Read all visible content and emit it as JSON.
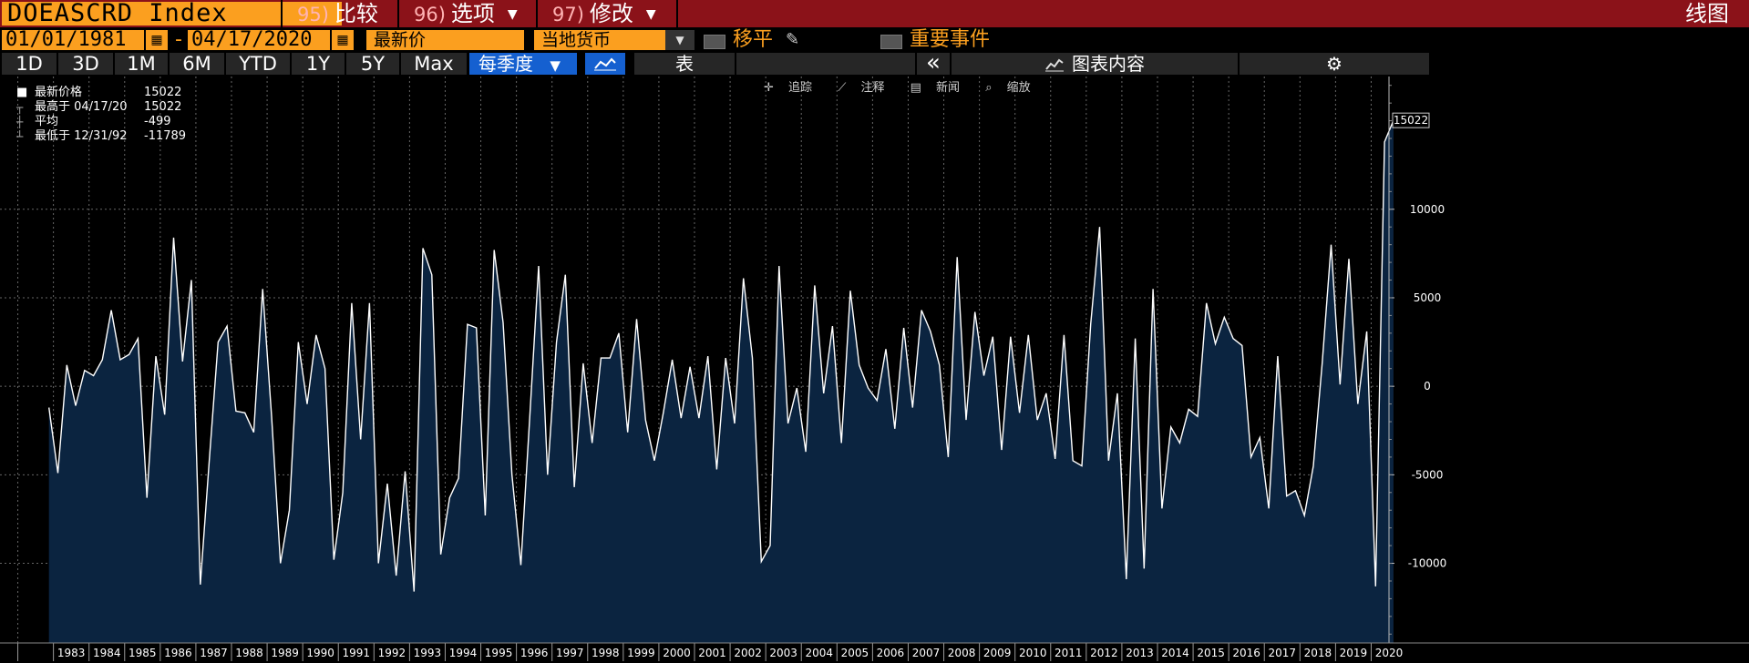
{
  "header": {
    "ticker": "DOEASCRD Index",
    "menu": [
      {
        "num": "95)",
        "label": "比较",
        "caret": false
      },
      {
        "num": "96)",
        "label": "选项",
        "caret": true
      },
      {
        "num": "97)",
        "label": "修改",
        "caret": true
      }
    ],
    "title_right": "线图"
  },
  "controls": {
    "start_date": "01/01/1981",
    "end_date": "04/17/2020",
    "dash": "-",
    "field": "最新价",
    "currency": "当地货币",
    "moving_avg_label": "移平",
    "events_label": "重要事件",
    "moving_avg_checked": false,
    "events_checked": false
  },
  "periods": [
    "1D",
    "3D",
    "1M",
    "6M",
    "YTD",
    "1Y",
    "5Y",
    "Max"
  ],
  "toolbar": {
    "frequency": "每季度",
    "table_label": "表",
    "collapse_glyph": "«",
    "chart_content_label": "图表内容"
  },
  "annotations": [
    "追踪",
    "注释",
    "新闻",
    "缩放"
  ],
  "legend": [
    {
      "label": "最新价格",
      "value": "15022",
      "marker": "square-icon"
    },
    {
      "label": "最高于 04/17/20",
      "value": "15022",
      "marker": "high-icon"
    },
    {
      "label": "平均",
      "value": "-499",
      "marker": "avg-icon"
    },
    {
      "label": "最低于 12/31/92",
      "value": "-11789",
      "marker": "low-icon"
    }
  ],
  "colors": {
    "header_bg": "#8b1219",
    "orange": "#fb9f1f",
    "line": "#ffffff",
    "area_fill": "#0b2440",
    "grid": "#666666",
    "freq_bg": "#1560d0"
  },
  "chart_data": {
    "type": "area",
    "title": "",
    "xlabel": "",
    "ylabel": "",
    "ylim": [
      -14500,
      17500
    ],
    "yticks": [
      -10000,
      -5000,
      0,
      5000,
      10000
    ],
    "ytick_labels": [
      "-10000",
      "-5000",
      "0",
      "5000",
      "10000"
    ],
    "last_value_label": "15022",
    "x_labels": [
      "1983",
      "1984",
      "1985",
      "1986",
      "1987",
      "1988",
      "1989",
      "1990",
      "1991",
      "1992",
      "1993",
      "1994",
      "1995",
      "1996",
      "1997",
      "1998",
      "1999",
      "2000",
      "2001",
      "2002",
      "2003",
      "2004",
      "2005",
      "2006",
      "2007",
      "2008",
      "2009",
      "2010",
      "2011",
      "2012",
      "2013",
      "2014",
      "2015",
      "2016",
      "2017",
      "2018",
      "2019",
      "2020"
    ],
    "first_year": 1981.5,
    "last_year": 2020.5,
    "grid": true,
    "series": [
      {
        "frequency": "quarterly",
        "start": "1982Q4",
        "values": [
          -1200,
          -4900,
          1200,
          -1100,
          900,
          600,
          1500,
          4300,
          1500,
          1800,
          2700,
          -6300,
          1700,
          -1600,
          8400,
          1400,
          6000,
          -11200,
          -4200,
          2500,
          3400,
          -1400,
          -1500,
          -2600,
          5500,
          -1700,
          -10000,
          -7000,
          2500,
          -1000,
          2900,
          1000,
          -9800,
          -6000,
          4700,
          -3000,
          4700,
          -10000,
          -5500,
          -10700,
          -4800,
          -11600,
          7800,
          6300,
          -9500,
          -6300,
          -5200,
          3500,
          3300,
          -7300,
          7700,
          3600,
          -5000,
          -10100,
          -1700,
          6800,
          -5000,
          2500,
          6300,
          -5700,
          1300,
          -3200,
          1600,
          1600,
          3000,
          -2600,
          3800,
          -1900,
          -4200,
          -1500,
          1500,
          -1800,
          1100,
          -1800,
          1700,
          -4700,
          1600,
          -2100,
          6100,
          1600,
          -9900,
          -9000,
          6800,
          -2100,
          -100,
          -3700,
          5700,
          -400,
          3400,
          -3200,
          5400,
          1200,
          -100,
          -800,
          2100,
          -2400,
          3300,
          -1200,
          4300,
          3100,
          1200,
          -4000,
          7300,
          -1900,
          4200,
          600,
          2800,
          -3600,
          2800,
          -1500,
          2900,
          -1900,
          -400,
          -4100,
          2900,
          -4200,
          -4500,
          3500,
          9000,
          -4200,
          -400,
          -10900,
          2700,
          -10300,
          5500,
          -6900,
          -2300,
          -3200,
          -1300,
          -1700,
          4700,
          2400,
          3900,
          2700,
          2300,
          -4000,
          -2900,
          -6900,
          1700,
          -6200,
          -5900,
          -7300,
          -4500,
          1300,
          8000,
          100,
          7200,
          -1000,
          3100,
          -11300,
          13800,
          15022
        ]
      }
    ]
  }
}
